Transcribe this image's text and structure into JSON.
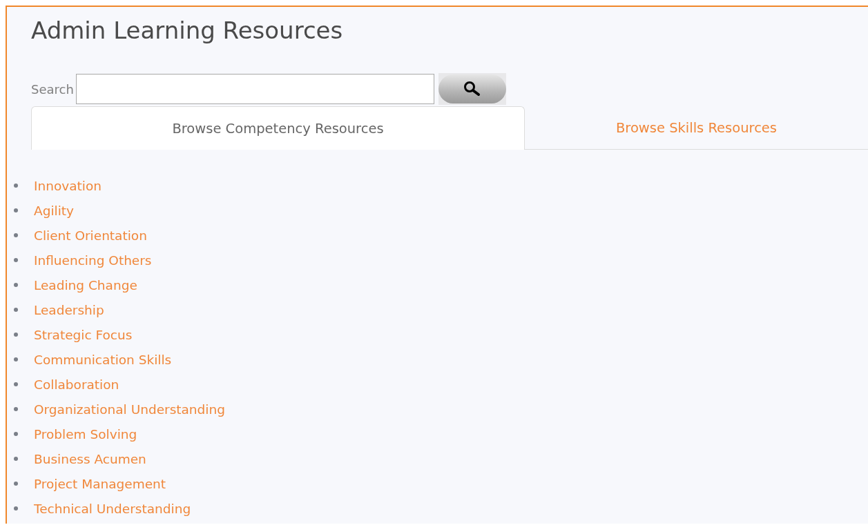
{
  "page": {
    "title": "Admin Learning Resources"
  },
  "search": {
    "label": "Search"
  },
  "tabs": [
    {
      "label": "Browse Competency Resources",
      "selected": true
    },
    {
      "label": "Browse Skills Resources",
      "selected": false
    }
  ],
  "competencies": [
    {
      "label": "Innovation"
    },
    {
      "label": "Agility"
    },
    {
      "label": "Client Orientation"
    },
    {
      "label": "Influencing Others"
    },
    {
      "label": "Leading Change"
    },
    {
      "label": "Leadership"
    },
    {
      "label": "Strategic Focus"
    },
    {
      "label": "Communication Skills"
    },
    {
      "label": "Collaboration"
    },
    {
      "label": "Organizational Understanding"
    },
    {
      "label": "Problem Solving"
    },
    {
      "label": "Business Acumen"
    },
    {
      "label": "Project Management"
    },
    {
      "label": "Technical Understanding"
    }
  ]
}
